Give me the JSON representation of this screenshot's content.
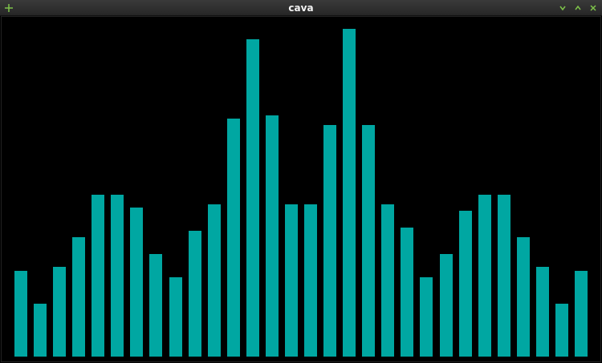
{
  "window": {
    "title": "cava"
  },
  "icons": {
    "new": "plus-icon",
    "minimize": "chevron-down-icon",
    "maximize": "chevron-up-icon",
    "close": "close-icon"
  },
  "colors": {
    "bar": "#00a7a2",
    "background": "#000000",
    "titlebar_icon": "#7ec24a"
  },
  "visualizer": {
    "bar_levels": [
      0.26,
      0.16,
      0.27,
      0.36,
      0.49,
      0.49,
      0.45,
      0.31,
      0.24,
      0.38,
      0.46,
      0.72,
      0.96,
      0.73,
      0.46,
      0.46,
      0.7,
      0.99,
      0.7,
      0.46,
      0.39,
      0.24,
      0.31,
      0.44,
      0.49,
      0.49,
      0.36,
      0.27,
      0.16,
      0.26
    ]
  }
}
